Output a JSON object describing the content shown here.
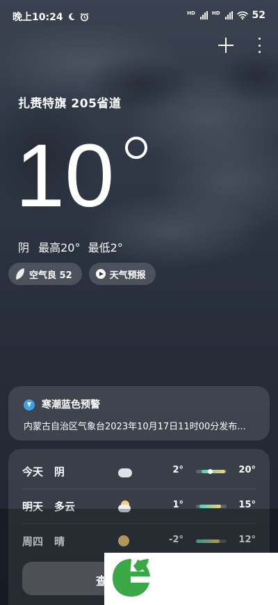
{
  "status_bar": {
    "time": "晚上10:24",
    "battery": "52",
    "network_label_1": "HD",
    "network_label_2": "HD"
  },
  "location": "扎赉特旗 205省道",
  "current": {
    "temperature": "10",
    "condition": "阴",
    "high_label": "最高20°",
    "low_label": "最低2°"
  },
  "pills": {
    "air_quality": "空气良 52",
    "forecast_video": "天气预报"
  },
  "alert": {
    "title": "寒潮蓝色预警",
    "description": "内蒙古自治区气象台2023年10月17日11时00分发布..."
  },
  "forecast": [
    {
      "day": "今天",
      "condition": "阴",
      "icon": "cloud-icon",
      "low": "2°",
      "high": "20°",
      "bar_start": 0.18,
      "bar_end": 0.96,
      "current_marker": 0.45
    },
    {
      "day": "明天",
      "condition": "多云",
      "icon": "partly-cloudy-icon",
      "low": "1°",
      "high": "15°",
      "bar_start": 0.12,
      "bar_end": 0.82
    },
    {
      "day": "周四",
      "condition": "晴",
      "icon": "sun-icon",
      "low": "-2°",
      "high": "12°",
      "bar_start": 0.0,
      "bar_end": 0.78
    }
  ],
  "bottom_button": {
    "label": "查"
  },
  "colors": {
    "alert_icon": "#3fa0e6",
    "bar_gradient_start": "#4fd1c5",
    "bar_gradient_end": "#f5cf7d",
    "logo_green": "#3aa845"
  }
}
